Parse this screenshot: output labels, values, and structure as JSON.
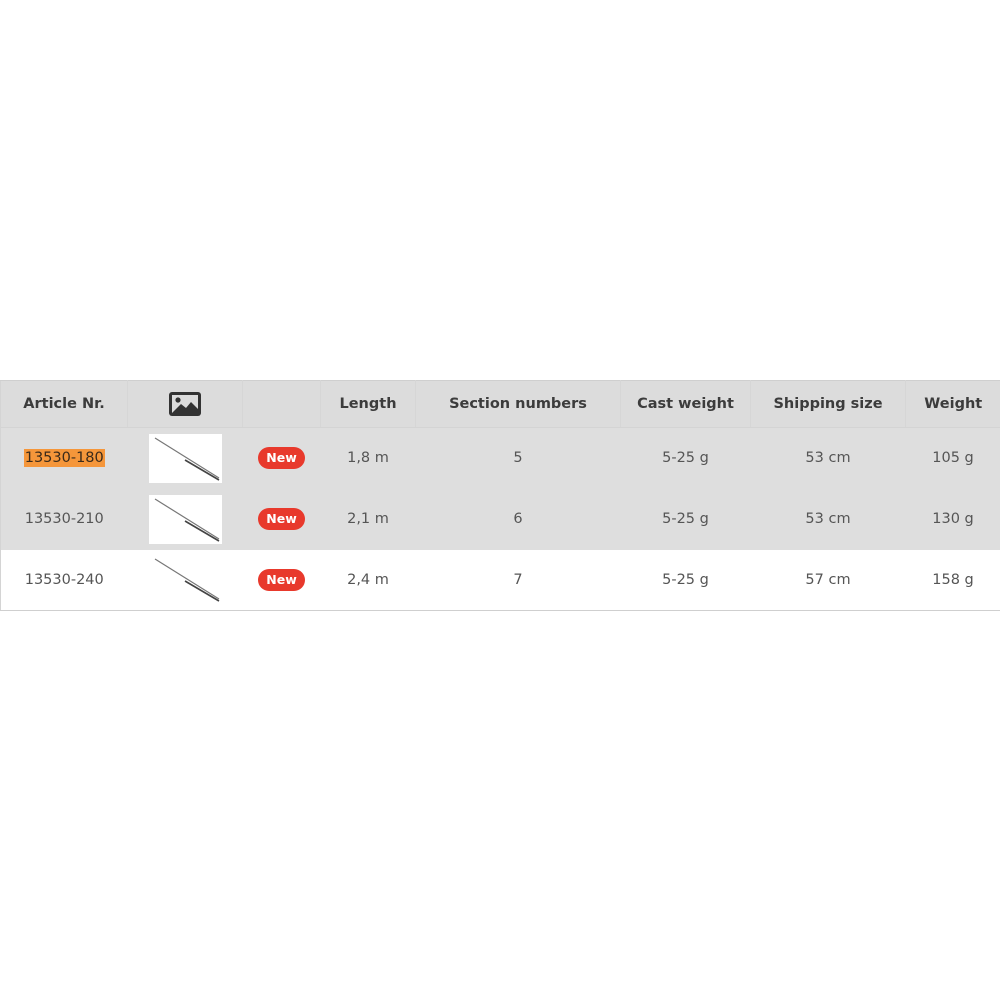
{
  "table": {
    "headers": {
      "article": "Article Nr.",
      "image_icon": "image-icon",
      "badge": "",
      "length": "Length",
      "sections": "Section numbers",
      "cast_weight": "Cast weight",
      "shipping_size": "Shipping size",
      "weight": "Weight"
    },
    "rows": [
      {
        "article": "13530-180",
        "highlighted": true,
        "badge": "New",
        "length": "1,8 m",
        "sections": "5",
        "cast_weight": "5-25 g",
        "shipping_size": "53 cm",
        "weight": "105 g"
      },
      {
        "article": "13530-210",
        "highlighted": false,
        "badge": "New",
        "length": "2,1 m",
        "sections": "6",
        "cast_weight": "5-25 g",
        "shipping_size": "53 cm",
        "weight": "130 g"
      },
      {
        "article": "13530-240",
        "highlighted": false,
        "badge": "New",
        "length": "2,4 m",
        "sections": "7",
        "cast_weight": "5-25 g",
        "shipping_size": "57 cm",
        "weight": "158 g"
      }
    ]
  },
  "colors": {
    "highlight": "#f5963a",
    "badge": "#e8392c",
    "header_bg": "#dcdcdc",
    "row_shade": "#dedede"
  }
}
